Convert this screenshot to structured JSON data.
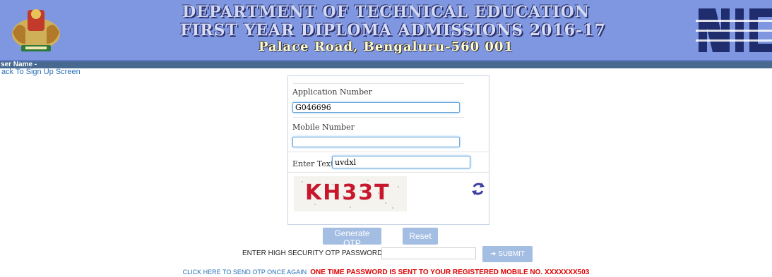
{
  "header": {
    "title_line1": "DEPARTMENT OF TECHNICAL EDUCATION",
    "title_line2": "FIRST YEAR DIPLOMA ADMISSIONS 2016-17",
    "title_line3": "Palace Road, Bengaluru-560 001",
    "left_logo": "karnataka-emblem",
    "right_logo": "NIC"
  },
  "user": {
    "label": "ser Name -"
  },
  "nav": {
    "back_link": "ack To Sign Up Screen"
  },
  "form": {
    "application_label": "Application Number",
    "application_value": "G046696",
    "mobile_label": "Mobile Number",
    "mobile_value": "",
    "captcha_label": "Enter Text",
    "captcha_input_value": "uvdxl",
    "captcha_text": "KH33T"
  },
  "buttons": {
    "generate_otp": "Generate OTP",
    "reset": "Reset",
    "submit": "SUBMIT"
  },
  "otp": {
    "label": "ENTER HIGH SECURITY OTP PASSWORD :",
    "value": ""
  },
  "footer": {
    "resend_link": "CLICK HERE TO SEND OTP ONCE AGAIN",
    "notice": "ONE TIME PASSWORD IS SENT TO YOUR REGISTERED MOBILE NO. XXXXXXX503"
  },
  "colors": {
    "banner": "#7f96e0",
    "user_bar": "#48698f",
    "button": "#a4bde3",
    "notice": "#e00000",
    "link": "#2a6fb7"
  }
}
